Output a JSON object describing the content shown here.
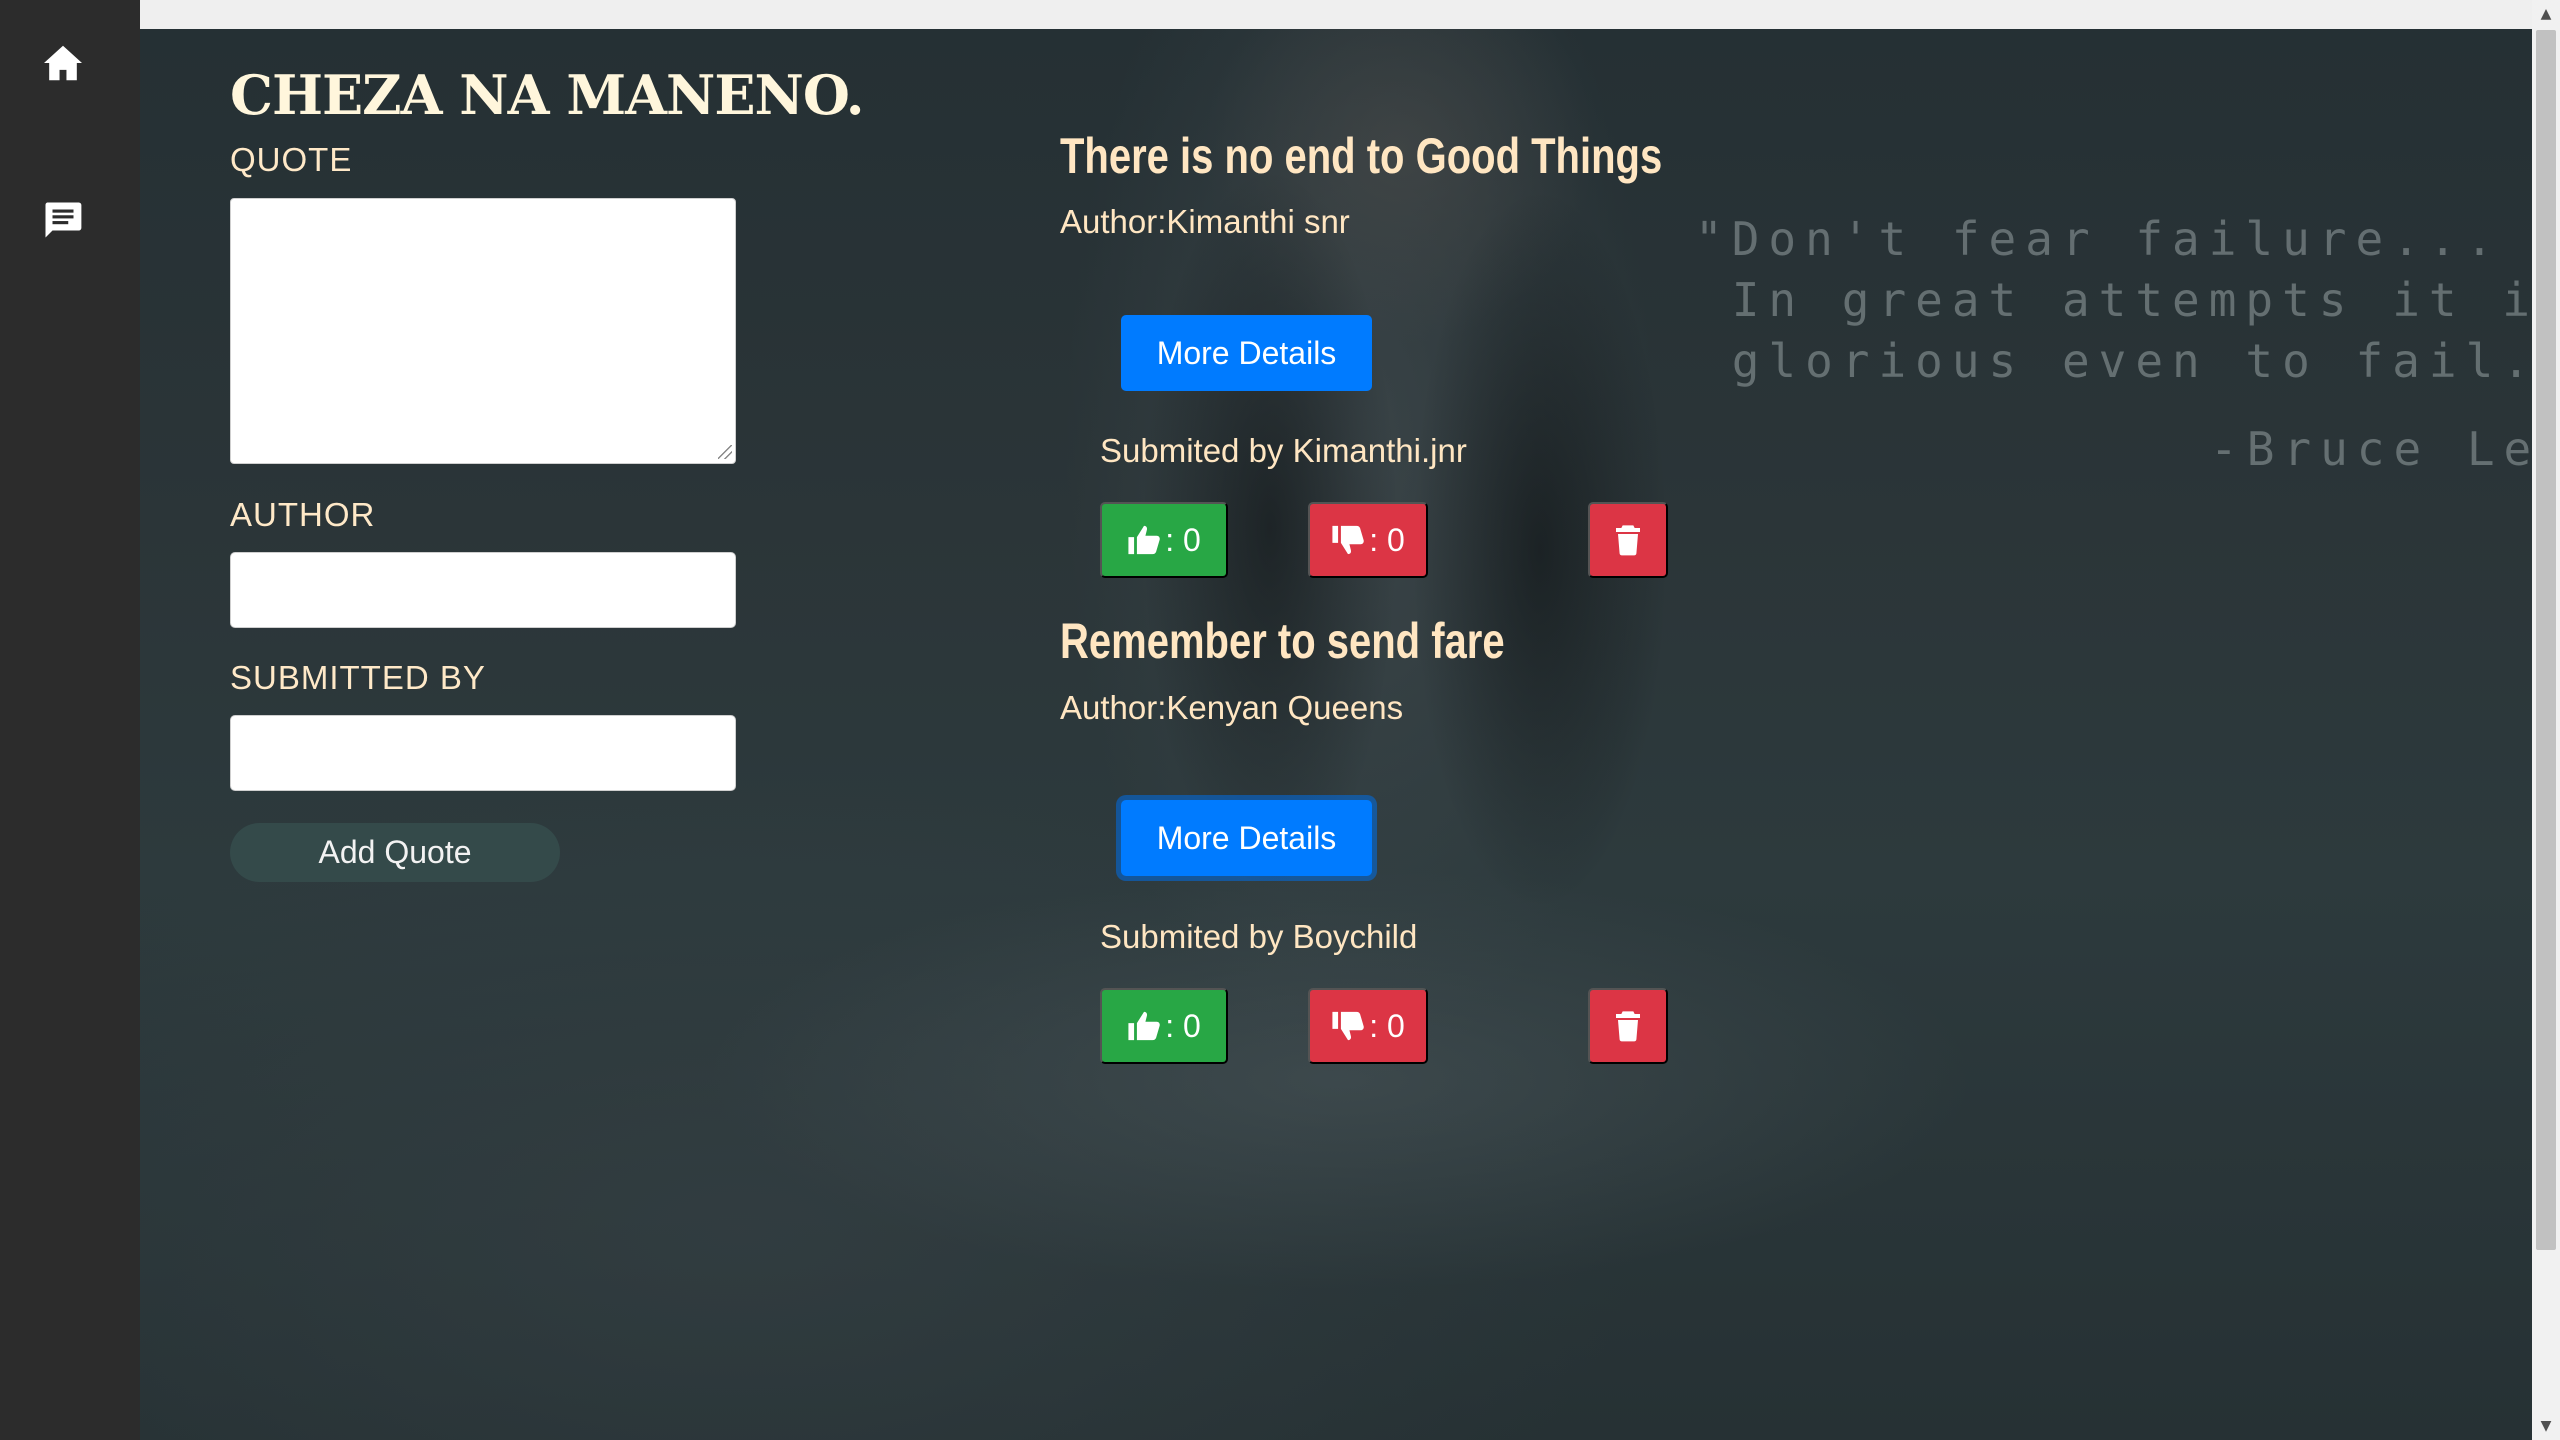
{
  "app": {
    "title": "CHEZA NA MANENO."
  },
  "sidebar": {
    "items": [
      {
        "icon": "home-icon"
      },
      {
        "icon": "message-icon"
      }
    ]
  },
  "form": {
    "quote_label": "QUOTE",
    "quote_value": "",
    "author_label": "AUTHOR",
    "author_value": "",
    "submitted_label": "SUBMITTED BY",
    "submitted_value": "",
    "add_button": "Add Quote"
  },
  "background_quote": {
    "text": "\"Don't fear failure...\n In great attempts it is\n glorious even to fail.",
    "author": "-Bruce Lee"
  },
  "quotes": [
    {
      "title": "There is no end to Good Things",
      "author": "Author:Kimanthi snr",
      "details_label": "More Details",
      "submitted": "Submited by Kimanthi.jnr",
      "upvotes": ": 0",
      "downvotes": ": 0"
    },
    {
      "title": "Remember to send fare",
      "author": "Author:Kenyan Queens",
      "details_label": "More Details",
      "submitted": "Submited by Boychild",
      "upvotes": ": 0",
      "downvotes": ": 0"
    }
  ],
  "colors": {
    "sidebar": "#2c2c2c",
    "upvote": "#28a745",
    "downvote": "#dc3545",
    "primary": "#007bff",
    "add_button": "#344a4a",
    "text": "#ffe6c2"
  }
}
